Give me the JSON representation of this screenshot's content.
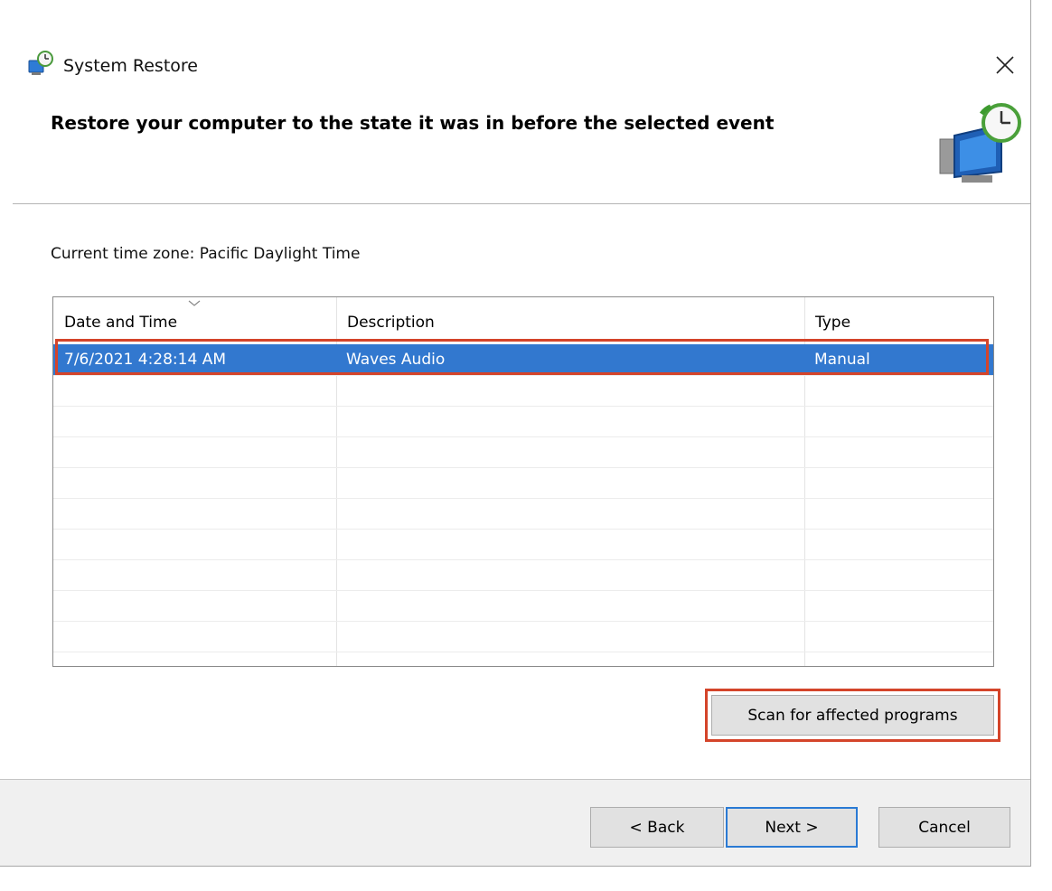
{
  "window": {
    "title": "System Restore",
    "header": "Restore your computer to the state it was in before the selected event"
  },
  "timezone_label": "Current time zone: Pacific Daylight Time",
  "list": {
    "columns": [
      "Date and Time",
      "Description",
      "Type"
    ],
    "rows": [
      {
        "date": "7/6/2021 4:28:14 AM",
        "description": "Waves Audio",
        "type": "Manual",
        "selected": true
      }
    ]
  },
  "buttons": {
    "scan": "Scan for affected programs",
    "back": "< Back",
    "next": "Next >",
    "cancel": "Cancel"
  },
  "colors": {
    "selection": "#3278cf",
    "highlight_outline": "#d4442a",
    "default_button_border": "#2a7ad4"
  },
  "icons": {
    "app": "system-restore-icon",
    "header": "restore-computer-icon",
    "close": "close-icon",
    "sort": "chevron-down-icon"
  }
}
